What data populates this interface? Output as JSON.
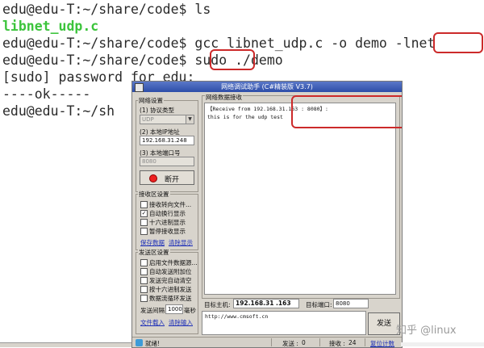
{
  "terminal": {
    "lines": [
      "edu@edu-T:~/share/code$ ls",
      "libnet_udp.c",
      "edu@edu-T:~/share/code$ gcc libnet_udp.c -o demo -lnet",
      "edu@edu-T:~/share/code$ sudo ./demo",
      "[sudo] password for edu:",
      "----ok-----",
      "edu@edu-T:~/sh"
    ],
    "colors": {
      "text": "#2a2a2a",
      "green": "#3cc43c",
      "highlight": "#cc2a2a"
    }
  },
  "app": {
    "title": "网络调试助手 (C#精装版 V3.7)",
    "network_settings": {
      "group_label": "网络设置",
      "protocol_label": "(1) 协议类型",
      "protocol_value": "UDP",
      "local_ip_label": "(2) 本地IP地址",
      "local_ip_value": "192.168.31.248",
      "local_port_label": "(3) 本地端口号",
      "local_port_value": "8080",
      "disconnect_label": "断开"
    },
    "receive_settings": {
      "group_label": "接收区设置",
      "options": [
        {
          "label": "接收转向文件...",
          "checked": false
        },
        {
          "label": "自动换行显示",
          "checked": true
        },
        {
          "label": "十六进制显示",
          "checked": false
        },
        {
          "label": "暂停接收显示",
          "checked": false
        }
      ],
      "save_data": "保存数据",
      "clear_display": "清除显示"
    },
    "send_settings": {
      "group_label": "发送区设置",
      "options": [
        {
          "label": "启用文件数据源...",
          "checked": false
        },
        {
          "label": "自动发送附加位",
          "checked": false
        },
        {
          "label": "发送完自动清空",
          "checked": false
        },
        {
          "label": "按十六进制发送",
          "checked": false
        },
        {
          "label": "数据流循环发送",
          "checked": false
        }
      ],
      "interval_label": "发送间隔",
      "interval_value": "1000",
      "interval_unit": "毫秒",
      "load_file": "文件载入",
      "clear_input": "清除输入"
    },
    "receive": {
      "group_label": "网络数据接收",
      "lines": [
        "【Receive from 192.168.31.163 : 8080】:",
        "this is for the udp test"
      ]
    },
    "target": {
      "host_label": "目标主机:",
      "host_value": "192.168.31 .163",
      "port_label": "目标端口:",
      "port_value": "8080"
    },
    "send": {
      "text": "http://www.cmsoft.cn",
      "button_label": "发送"
    },
    "status": {
      "ready": "就绪!",
      "sent_label": "发送 :",
      "sent_count": "0",
      "recv_label": "接收 :",
      "recv_count": "24",
      "reset_label": "复位计数"
    },
    "colors": {
      "accent_red": "#ee2020",
      "title_bar": "#2d4da8",
      "window_bg": "#d8d4cc"
    }
  },
  "watermark": "知乎 @linux"
}
